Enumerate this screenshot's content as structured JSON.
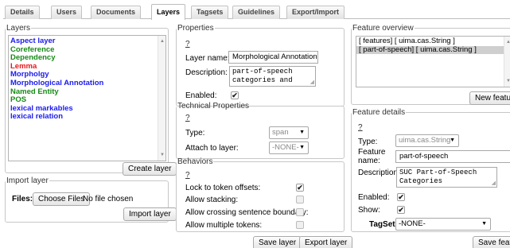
{
  "tabs": [
    "Details",
    "Users",
    "Documents",
    "Layers",
    "Tagsets",
    "Guidelines",
    "Export/Import"
  ],
  "active_tab": "Layers",
  "layers_panel": {
    "legend": "Layers",
    "items": [
      {
        "label": "Aspect layer",
        "color": "#1a1aee"
      },
      {
        "label": "Coreference",
        "color": "#178a17"
      },
      {
        "label": "Dependency",
        "color": "#178a17"
      },
      {
        "label": "Lemma",
        "color": "#e8171a"
      },
      {
        "label": "Morpholgy",
        "color": "#1a1aee"
      },
      {
        "label": "Morphological Annotation",
        "color": "#1a1aee"
      },
      {
        "label": "Named Entity",
        "color": "#178a17"
      },
      {
        "label": "POS",
        "color": "#178a17"
      },
      {
        "label": "lexical markables",
        "color": "#1a1aee"
      },
      {
        "label": "lexical relation",
        "color": "#1a1aee"
      }
    ],
    "create_button": "Create layer"
  },
  "import_panel": {
    "legend": "Import layer",
    "files_label": "Files:",
    "choose_button": "Choose Files",
    "no_file_text": "No file chosen",
    "import_button": "Import layer"
  },
  "properties": {
    "legend": "Properties",
    "help": "?",
    "layer_name_label": "Layer name:",
    "layer_name_value": "Morphological Annotation",
    "description_label": "Description:",
    "description_value": "part-of-speech categories and",
    "enabled_label": "Enabled:",
    "enabled_checked": true
  },
  "technical": {
    "legend": "Technical Properties",
    "help": "?",
    "type_label": "Type:",
    "type_value": "span",
    "attach_label": "Attach to layer:",
    "attach_value": "-NONE-"
  },
  "behaviors": {
    "legend": "Behaviors",
    "help": "?",
    "lock_label": "Lock to token offsets:",
    "lock_checked": true,
    "stacking_label": "Allow stacking:",
    "stacking_checked": false,
    "crossing_label": "Allow crossing sentence boundary:",
    "crossing_checked": false,
    "multiple_label": "Allow multiple tokens:",
    "multiple_checked": false
  },
  "layer_buttons": {
    "save": "Save layer",
    "export": "Export layer"
  },
  "feature_overview": {
    "legend": "Feature overview",
    "items": [
      "[ features] [ uima.cas.String ]",
      "[ part-of-speech] [ uima.cas.String ]"
    ],
    "selected_index": 1,
    "new_button": "New feature"
  },
  "feature_details": {
    "legend": "Feature details",
    "help": "?",
    "type_label": "Type:",
    "type_value": "uima.cas.String",
    "feature_name_label_1": "Feature",
    "feature_name_label_2": "name:",
    "feature_name_value": "part-of-speech",
    "description_label": "Description:",
    "description_value": "SUC Part-of-Speech Categories",
    "enabled_label": "Enabled:",
    "enabled_checked": true,
    "show_label": "Show:",
    "show_checked": true,
    "tagset_label": "TagSet:",
    "tagset_value": "-NONE-",
    "save_button": "Save feature"
  },
  "colors": {
    "selected_row": "#cfcfcf",
    "border": "#c7c7c7"
  }
}
